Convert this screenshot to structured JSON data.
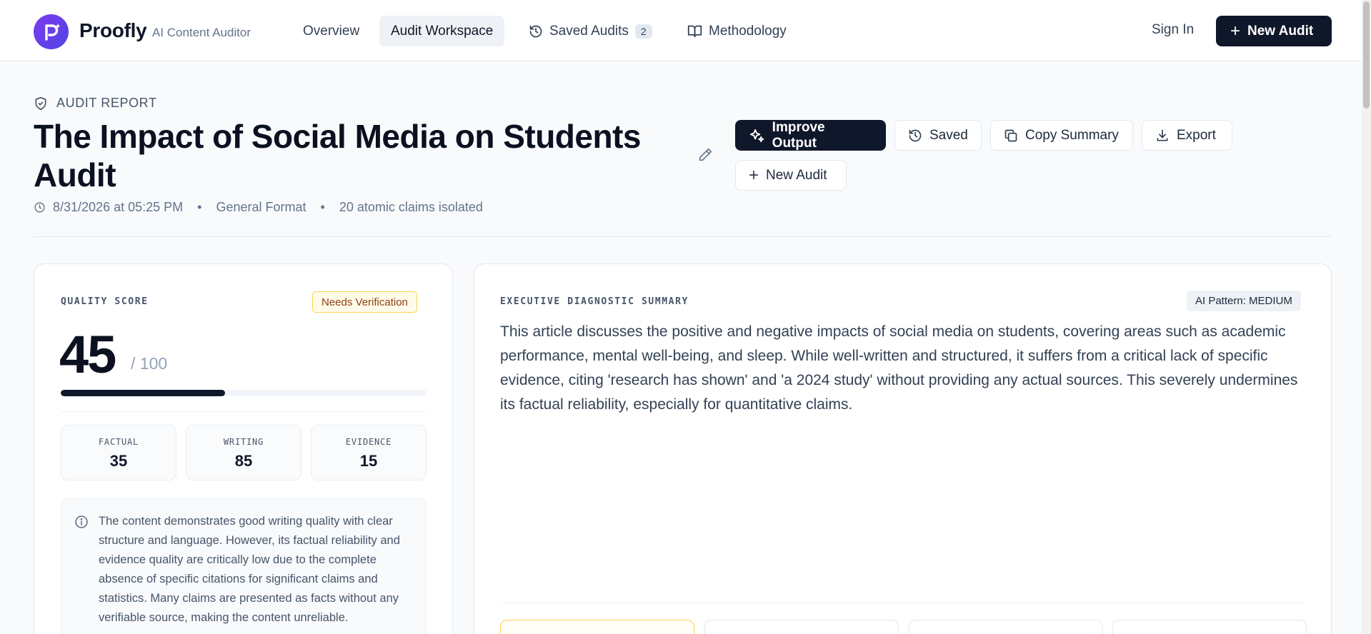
{
  "header": {
    "brand": "Proofly",
    "brand_sub": "AI Content Auditor",
    "nav": [
      {
        "label": "Overview"
      },
      {
        "label": "Audit Workspace"
      },
      {
        "label": "Saved Audits",
        "badge": "2"
      },
      {
        "label": "Methodology"
      }
    ],
    "sign_in": "Sign In",
    "new_audit": "New Audit"
  },
  "report": {
    "eyebrow": "AUDIT REPORT",
    "title": "The Impact of Social Media on Students Audit",
    "timestamp": "8/31/2026 at 05:25 PM",
    "format": "General Format",
    "claims": "20 atomic claims isolated",
    "actions": {
      "improve": "Improve Output",
      "saved": "Saved",
      "copy": "Copy Summary",
      "export": "Export",
      "new_audit": "New Audit"
    }
  },
  "quality": {
    "label": "QUALITY SCORE",
    "badge": "Needs Verification",
    "score": "45",
    "max": "/ 100",
    "progress_percent": 45,
    "metrics": [
      {
        "label": "FACTUAL",
        "value": "35"
      },
      {
        "label": "WRITING",
        "value": "85"
      },
      {
        "label": "EVIDENCE",
        "value": "15"
      }
    ],
    "note": "The content demonstrates good writing quality with clear structure and language. However, its factual reliability and evidence quality are critically low due to the complete absence of specific citations for significant claims and statistics. Many claims are presented as facts without any verifiable source, making the content unreliable."
  },
  "summary": {
    "label": "EXECUTIVE DIAGNOSTIC SUMMARY",
    "pattern": "AI Pattern: MEDIUM",
    "text": "This article discusses the positive and negative impacts of social media on students, covering areas such as academic performance, mental well-being, and sleep. While well-written and structured, it suffers from a critical lack of specific evidence, citing 'research has shown' and 'a 2024 study' without providing any actual sources. This severely undermines its factual reliability, especially for quantitative claims."
  },
  "colors": {
    "primary": "#0f172a",
    "brand_gradient_start": "#7c3aed",
    "brand_gradient_end": "#4f46e5",
    "warning_border": "#fcd34d"
  }
}
